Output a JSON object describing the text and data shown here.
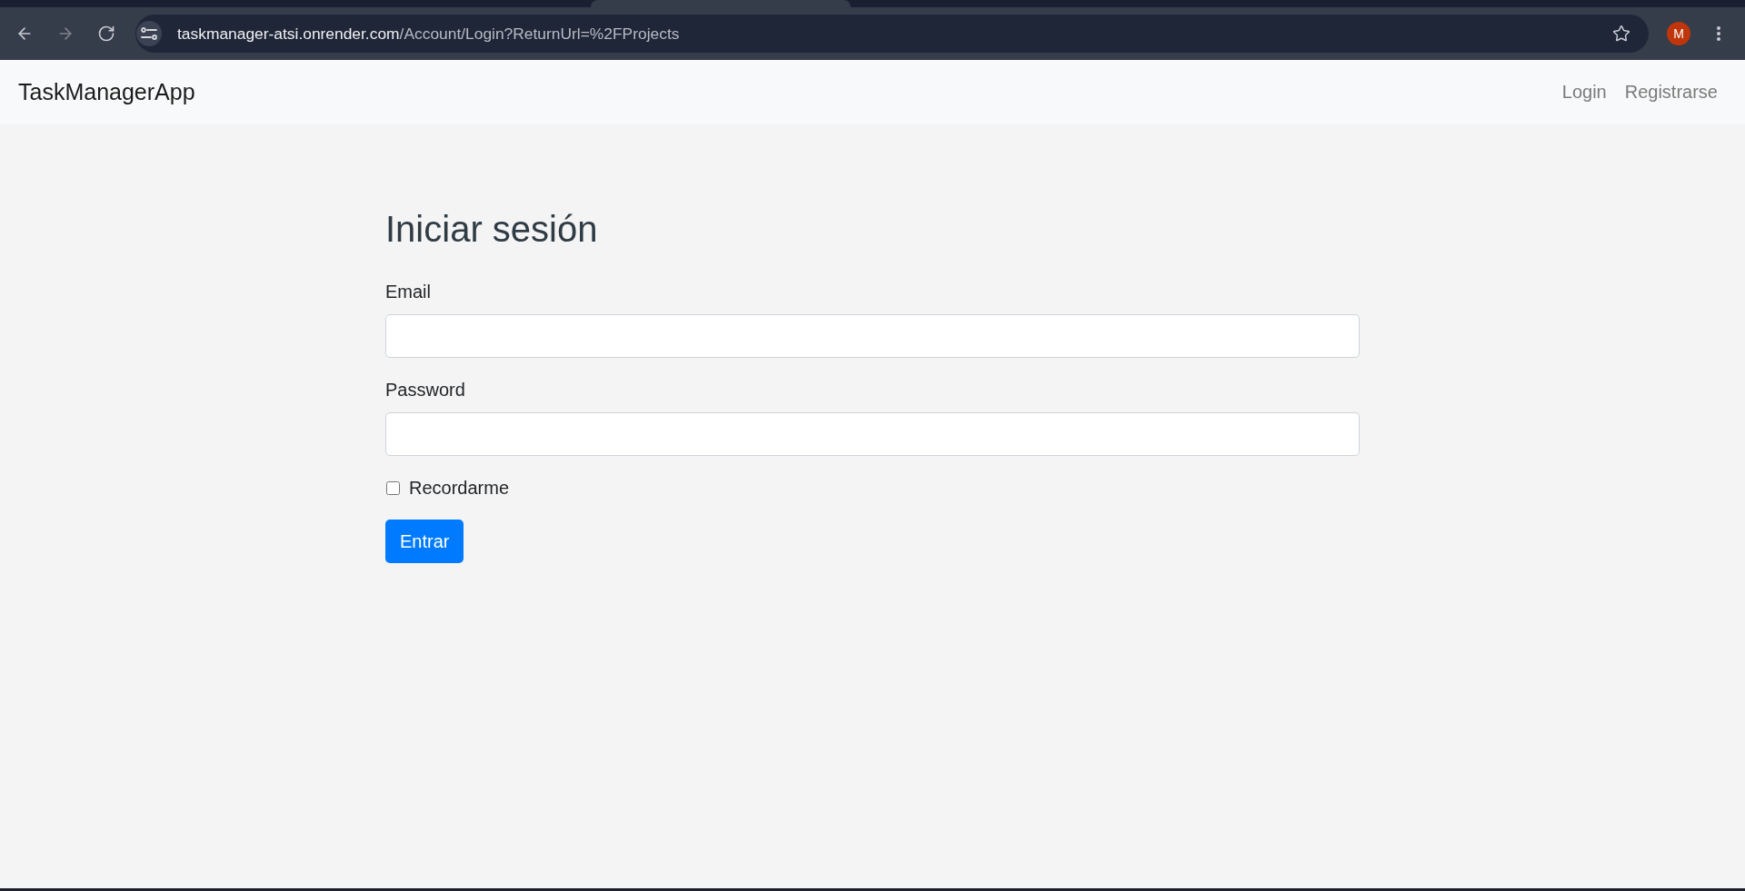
{
  "browser": {
    "nav_buttons": [
      {
        "kind": "back",
        "disabled": false
      },
      {
        "kind": "forward",
        "disabled": true
      },
      {
        "kind": "reload",
        "disabled": false
      }
    ],
    "url_host": "taskmanager-atsi.onrender.com",
    "url_path": "/Account/Login?ReturnUrl=%2FProjects",
    "profile_initial": "M"
  },
  "navbar": {
    "brand": "TaskManagerApp",
    "links": [
      {
        "label": "Login"
      },
      {
        "label": "Registrarse"
      }
    ]
  },
  "form": {
    "title": "Iniciar sesión",
    "fields": [
      {
        "label": "Email"
      },
      {
        "label": "Password"
      }
    ],
    "remember": {
      "label": "Recordarme",
      "checked": false
    },
    "submit": "Entrar"
  }
}
